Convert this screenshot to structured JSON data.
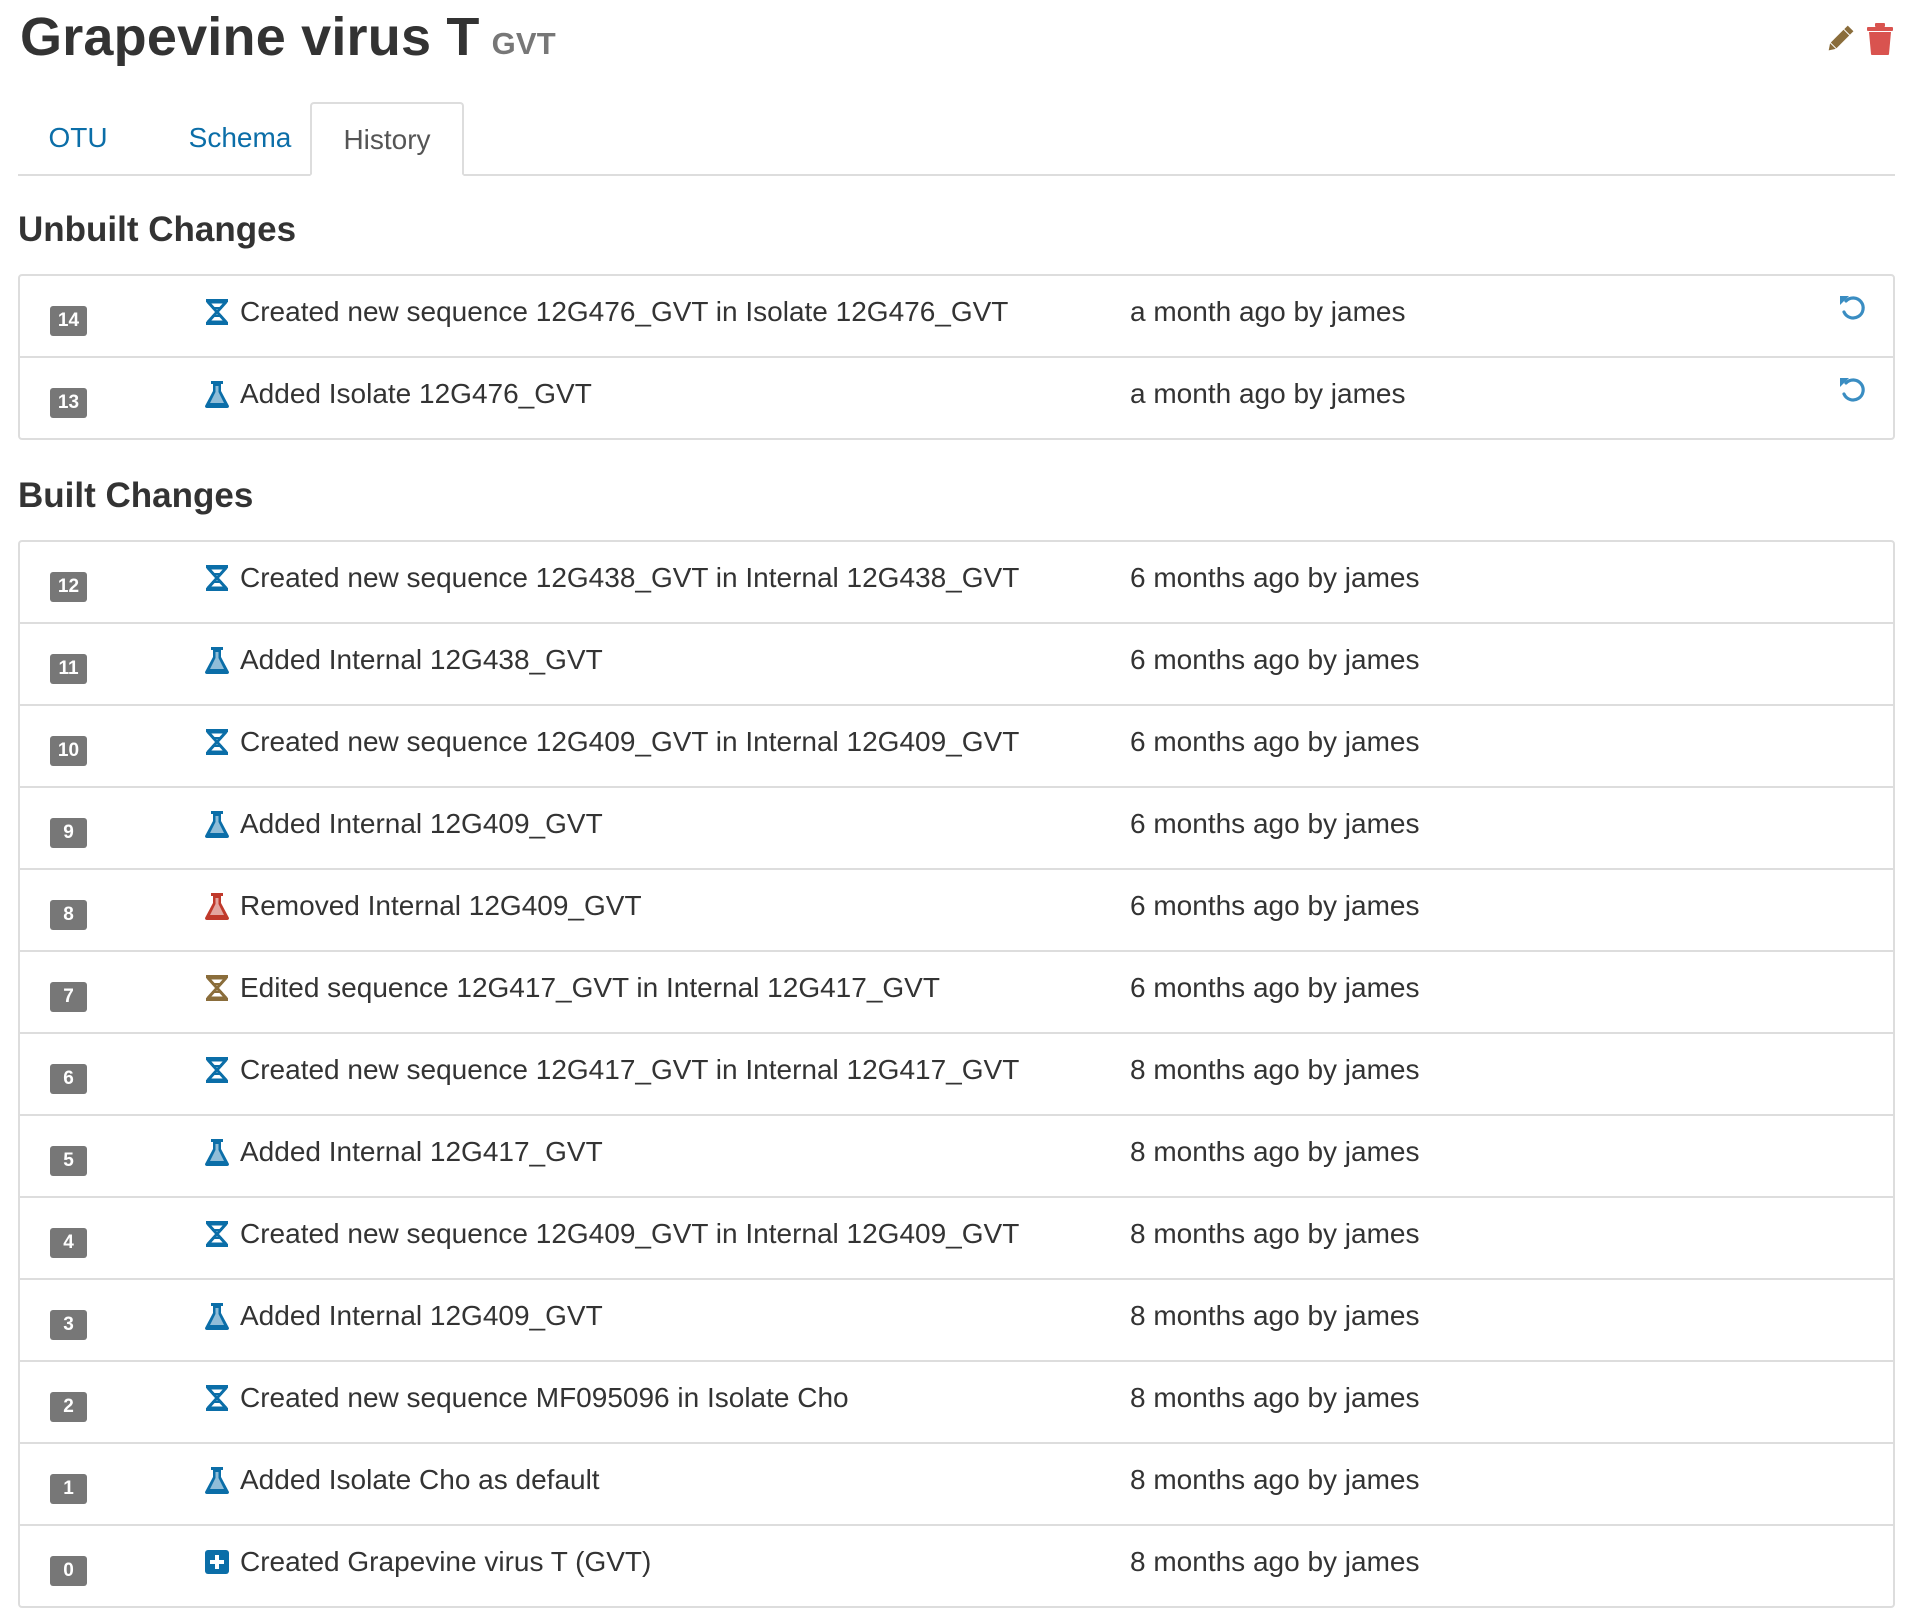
{
  "header": {
    "title": "Grapevine virus T",
    "abbreviation": "GVT",
    "edit_icon": "pencil-icon",
    "remove_icon": "trash-icon",
    "edit_color": "#8a6d3b",
    "remove_color": "#d9534f"
  },
  "tabs": [
    {
      "label": "OTU",
      "active": false
    },
    {
      "label": "Schema",
      "active": false
    },
    {
      "label": "History",
      "active": true
    }
  ],
  "unbuilt": {
    "title": "Unbuilt Changes",
    "items": [
      {
        "index": "14",
        "icon": "sequence-icon",
        "icon_color": "#0b6ea8",
        "description": "Created new sequence 12G476_GVT in Isolate 12G476_GVT",
        "when": "a month ago by james",
        "revert_icon": "undo-icon"
      },
      {
        "index": "13",
        "icon": "flask-icon",
        "icon_color": "#0b6ea8",
        "description": "Added Isolate 12G476_GVT",
        "when": "a month ago by james",
        "revert_icon": "undo-icon"
      }
    ]
  },
  "built": {
    "title": "Built Changes",
    "items": [
      {
        "index": "12",
        "icon": "sequence-icon",
        "icon_color": "#0b6ea8",
        "description": "Created new sequence 12G438_GVT in Internal 12G438_GVT",
        "when": "6 months ago by james"
      },
      {
        "index": "11",
        "icon": "flask-icon",
        "icon_color": "#0b6ea8",
        "description": "Added Internal 12G438_GVT",
        "when": "6 months ago by james"
      },
      {
        "index": "10",
        "icon": "sequence-icon",
        "icon_color": "#0b6ea8",
        "description": "Created new sequence 12G409_GVT in Internal 12G409_GVT",
        "when": "6 months ago by james"
      },
      {
        "index": "9",
        "icon": "flask-icon",
        "icon_color": "#0b6ea8",
        "description": "Added Internal 12G409_GVT",
        "when": "6 months ago by james"
      },
      {
        "index": "8",
        "icon": "flask-icon",
        "icon_color": "#c0392b",
        "description": "Removed Internal 12G409_GVT",
        "when": "6 months ago by james"
      },
      {
        "index": "7",
        "icon": "sequence-icon",
        "icon_color": "#8a6d3b",
        "description": "Edited sequence 12G417_GVT in Internal 12G417_GVT",
        "when": "6 months ago by james"
      },
      {
        "index": "6",
        "icon": "sequence-icon",
        "icon_color": "#0b6ea8",
        "description": "Created new sequence 12G417_GVT in Internal 12G417_GVT",
        "when": "8 months ago by james"
      },
      {
        "index": "5",
        "icon": "flask-icon",
        "icon_color": "#0b6ea8",
        "description": "Added Internal 12G417_GVT",
        "when": "8 months ago by james"
      },
      {
        "index": "4",
        "icon": "sequence-icon",
        "icon_color": "#0b6ea8",
        "description": "Created new sequence 12G409_GVT in Internal 12G409_GVT",
        "when": "8 months ago by james"
      },
      {
        "index": "3",
        "icon": "flask-icon",
        "icon_color": "#0b6ea8",
        "description": "Added Internal 12G409_GVT",
        "when": "8 months ago by james"
      },
      {
        "index": "2",
        "icon": "sequence-icon",
        "icon_color": "#0b6ea8",
        "description": "Created new sequence MF095096 in Isolate Cho",
        "when": "8 months ago by james"
      },
      {
        "index": "1",
        "icon": "flask-icon",
        "icon_color": "#0b6ea8",
        "description": "Added Isolate Cho as default",
        "when": "8 months ago by james"
      },
      {
        "index": "0",
        "icon": "plus-square-icon",
        "icon_color": "#0b6ea8",
        "description": "Created Grapevine virus T (GVT)",
        "when": "8 months ago by james"
      }
    ]
  }
}
